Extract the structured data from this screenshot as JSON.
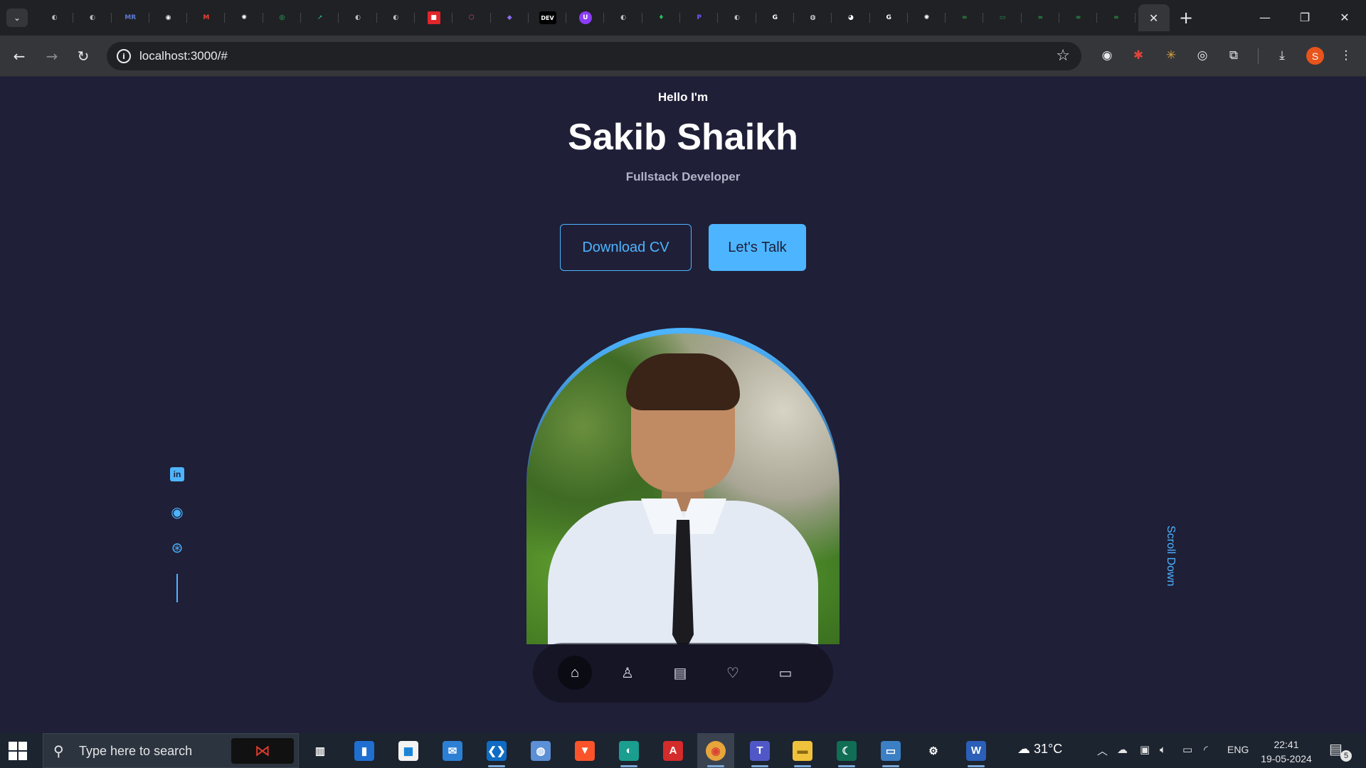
{
  "browser": {
    "url": "localhost:3000/#",
    "tabs": [
      {
        "icon": "globe-icon",
        "color": "#bdc1c6",
        "glyph": "◐"
      },
      {
        "icon": "globe-icon",
        "color": "#bdc1c6",
        "glyph": "◐"
      },
      {
        "icon": "mrt-icon",
        "color": "#5b7bd5",
        "glyph": "MR"
      },
      {
        "icon": "github-icon",
        "color": "#ffffff",
        "glyph": "◉"
      },
      {
        "icon": "gmail-icon",
        "color": "#ea4335",
        "glyph": "M"
      },
      {
        "icon": "openai-icon",
        "color": "#ffffff",
        "glyph": "✺"
      },
      {
        "icon": "green-circle-icon",
        "color": "#27c96b",
        "glyph": "◎"
      },
      {
        "icon": "teal-arrow-icon",
        "color": "#2bb9a5",
        "glyph": "➚"
      },
      {
        "icon": "globe-icon",
        "color": "#bdc1c6",
        "glyph": "◐"
      },
      {
        "icon": "globe-icon",
        "color": "#bdc1c6",
        "glyph": "◐"
      },
      {
        "icon": "red-square-icon",
        "color": "#e0262b",
        "glyph": "■"
      },
      {
        "icon": "pink-hex-icon",
        "color": "#d64a86",
        "glyph": "⬡"
      },
      {
        "icon": "copilot-icon",
        "color": "#8a6cf0",
        "glyph": "◆"
      },
      {
        "icon": "dev-icon",
        "color": "#000000",
        "glyph": "DEV"
      },
      {
        "icon": "purple-u-icon",
        "color": "#8b3cf7",
        "glyph": "U"
      },
      {
        "icon": "globe-icon",
        "color": "#bdc1c6",
        "glyph": "◐"
      },
      {
        "icon": "leaf-icon",
        "color": "#21c15c",
        "glyph": "♦"
      },
      {
        "icon": "purple-p-icon",
        "color": "#7057ff",
        "glyph": "P"
      },
      {
        "icon": "globe-icon",
        "color": "#bdc1c6",
        "glyph": "◐"
      },
      {
        "icon": "google-icon",
        "color": "#ffffff",
        "glyph": "G"
      },
      {
        "icon": "circle-app-icon",
        "color": "#ffffff",
        "glyph": "◍"
      },
      {
        "icon": "google-lens-icon",
        "color": "#ffffff",
        "glyph": "◕"
      },
      {
        "icon": "google-icon",
        "color": "#ffffff",
        "glyph": "G"
      },
      {
        "icon": "openai-icon",
        "color": "#ffffff",
        "glyph": "✺"
      },
      {
        "icon": "infinity-icon",
        "color": "#2f9a4e",
        "glyph": "∞"
      },
      {
        "icon": "green-pill-icon",
        "color": "#2f9a4e",
        "glyph": "▭"
      },
      {
        "icon": "infinity-icon",
        "color": "#2f9a4e",
        "glyph": "∞"
      },
      {
        "icon": "infinity-icon",
        "color": "#2f9a4e",
        "glyph": "∞"
      },
      {
        "icon": "infinity-icon",
        "color": "#2f9a4e",
        "glyph": "∞"
      }
    ],
    "extensions": [
      {
        "icon": "circle-extension-icon",
        "glyph": "◉"
      },
      {
        "icon": "red-extension-icon",
        "glyph": "✱"
      },
      {
        "icon": "cookie-extension-icon",
        "glyph": "✳"
      },
      {
        "icon": "target-extension-icon",
        "glyph": "◎"
      },
      {
        "icon": "puzzle-extension-icon",
        "glyph": "⧉"
      }
    ],
    "profile_initial": "S"
  },
  "hero": {
    "greeting": "Hello I'm",
    "name": "Sakib Shaikh",
    "role": "Fullstack Developer",
    "download_cv": "Download CV",
    "lets_talk": "Let's Talk",
    "scroll_down": "Scroll Down",
    "accent_color": "#4db5ff",
    "background_color": "#1f1f38"
  },
  "social": [
    {
      "name": "linkedin-icon",
      "glyph": "in"
    },
    {
      "name": "github-icon",
      "glyph": "◉"
    },
    {
      "name": "dribbble-icon",
      "glyph": "⊛"
    }
  ],
  "nav": [
    {
      "name": "home-icon",
      "glyph": "⌂",
      "active": true
    },
    {
      "name": "user-icon",
      "glyph": "♙",
      "active": false
    },
    {
      "name": "book-icon",
      "glyph": "▤",
      "active": false
    },
    {
      "name": "services-icon",
      "glyph": "♡",
      "active": false
    },
    {
      "name": "message-icon",
      "glyph": "▭",
      "active": false
    }
  ],
  "taskbar": {
    "search_placeholder": "Type here to search",
    "weather": "31°C",
    "language": "ENG",
    "time": "22:41",
    "date": "19-05-2024",
    "notifications": "5",
    "apps": [
      {
        "name": "task-view-icon",
        "glyph": "▥",
        "bg": "transparent",
        "fg": "#ffffff"
      },
      {
        "name": "file-app-icon",
        "glyph": "▮",
        "bg": "#1f6fd1",
        "fg": "#ffffff"
      },
      {
        "name": "store-icon",
        "glyph": "▦",
        "bg": "#f3f3f3",
        "fg": "#0078d4"
      },
      {
        "name": "mail-icon",
        "glyph": "✉",
        "bg": "#2d7fd3",
        "fg": "#ffffff"
      },
      {
        "name": "vscode-icon",
        "glyph": "❮❯",
        "bg": "#0e6cc4",
        "fg": "#ffffff"
      },
      {
        "name": "globe-app-icon",
        "glyph": "◍",
        "bg": "#5b8fd6",
        "fg": "#ffffff"
      },
      {
        "name": "brave-icon",
        "glyph": "▼",
        "bg": "#fb542b",
        "fg": "#ffffff"
      },
      {
        "name": "edge-icon",
        "glyph": "◐",
        "bg": "#1a9e8f",
        "fg": "#ffffff"
      },
      {
        "name": "pdf-icon",
        "glyph": "A",
        "bg": "#d42b2b",
        "fg": "#ffffff"
      },
      {
        "name": "chrome-icon",
        "glyph": "◉",
        "bg": "#e7a53b",
        "fg": "#db4437"
      },
      {
        "name": "teams-icon",
        "glyph": "T",
        "bg": "#5058c7",
        "fg": "#ffffff"
      },
      {
        "name": "explorer-icon",
        "glyph": "▬",
        "bg": "#f0c23c",
        "fg": "#8a6a12"
      },
      {
        "name": "moon-app-icon",
        "glyph": "☾",
        "bg": "#0f6e54",
        "fg": "#ffffff"
      },
      {
        "name": "monitor-app-icon",
        "glyph": "▭",
        "bg": "#3b7fc4",
        "fg": "#ffffff"
      },
      {
        "name": "settings-icon",
        "glyph": "⚙",
        "bg": "transparent",
        "fg": "#ffffff"
      },
      {
        "name": "word-icon",
        "glyph": "W",
        "bg": "#2b5fb8",
        "fg": "#ffffff"
      }
    ]
  }
}
